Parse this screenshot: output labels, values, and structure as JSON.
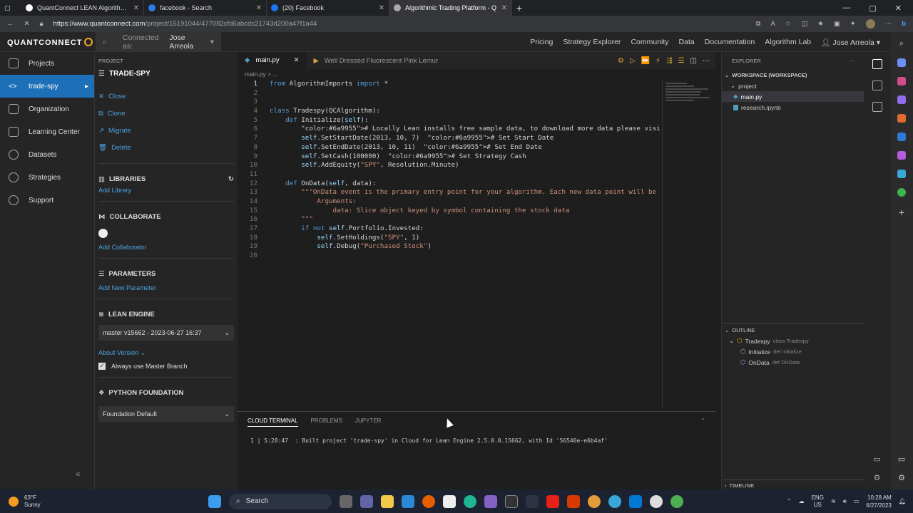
{
  "browser": {
    "tabs": [
      {
        "title": "QuantConnect LEAN Algorithmic",
        "color": "#ffffff"
      },
      {
        "title": "facebook - Search",
        "color": "#2b7de9"
      },
      {
        "title": "(20) Facebook",
        "color": "#1877f2"
      },
      {
        "title": "Algorithmic Trading Platform - Q",
        "color": "#aaaaaa"
      }
    ],
    "url_host": "https://www.quantconnect.com",
    "url_path": "/project/15191044/477082cfd6abcdc21743d200a47f1a44"
  },
  "topnav": {
    "logo": "QUANTCONNECT",
    "connected_label": "Connected as:",
    "connected_user": "Jose Arreola",
    "menu": [
      "Pricing",
      "Strategy Explorer",
      "Community",
      "Data",
      "Documentation",
      "Algorithm Lab"
    ],
    "user": "Jose Arreola"
  },
  "sidebar": {
    "items": [
      {
        "label": "Projects"
      },
      {
        "label": "trade-spy"
      },
      {
        "label": "Organization"
      },
      {
        "label": "Learning Center"
      },
      {
        "label": "Datasets"
      },
      {
        "label": "Strategies"
      },
      {
        "label": "Support"
      }
    ]
  },
  "project": {
    "header": "PROJECT",
    "name": "TRADE-SPY",
    "actions": [
      "Close",
      "Clone",
      "Migrate",
      "Delete"
    ],
    "libraries": "LIBRARIES",
    "add_library": "Add Library",
    "collaborate": "COLLABORATE",
    "add_collaborator": "Add Collaborator",
    "parameters": "PARAMETERS",
    "add_parameter": "Add New Parameter",
    "lean_engine": "LEAN ENGINE",
    "engine_version": "master v15662 - 2023-06-27 16:37",
    "about_version": "About Version",
    "master_branch": "Always use Master Branch",
    "python_foundation": "PYTHON FOUNDATION",
    "foundation_value": "Foundation Default"
  },
  "editor": {
    "tabs": [
      "main.py",
      "Well Dressed Fluorescent Pink Lemur"
    ],
    "breadcrumb": "main.py > ...",
    "lines": [
      "from AlgorithmImports import *",
      "",
      "",
      "class Tradespy(QCAlgorithm):",
      "    def Initialize(self):",
      "        # Locally Lean installs free sample data, to download more data please visit https://www.quantconne",
      "        self.SetStartDate(2013, 10, 7)  # Set Start Date",
      "        self.SetEndDate(2013, 10, 11)  # Set End Date",
      "        self.SetCash(100000)  # Set Strategy Cash",
      "        self.AddEquity(\"SPY\", Resolution.Minute)",
      "",
      "    def OnData(self, data):",
      "        \"\"\"OnData event is the primary entry point for your algorithm. Each new data point will be pumped i",
      "            Arguments:",
      "                data: Slice object keyed by symbol containing the stock data",
      "        \"\"\"",
      "        if not self.Portfolio.Invested:",
      "            self.SetHoldings(\"SPY\", 1)",
      "            self.Debug(\"Purchased Stock\")",
      ""
    ]
  },
  "terminal": {
    "tabs": [
      "CLOUD TERMINAL",
      "PROBLEMS",
      "JUPYTER"
    ],
    "line": "1 | 5:28:47  : Built project 'trade-spy' in Cloud for Lean Engine 2.5.0.0.15662, with Id '56546e-e6b4af'"
  },
  "explorer": {
    "header": "EXPLORER",
    "workspace": "WORKSPACE (WORKSPACE)",
    "folder": "project",
    "files": [
      "main.py",
      "research.ipynb"
    ],
    "outline": "OUTLINE",
    "outline_items": [
      {
        "name": "Tradespy",
        "kind": "class Tradespy"
      },
      {
        "name": "Initialize",
        "kind": "def Initialize"
      },
      {
        "name": "OnData",
        "kind": "def OnData"
      }
    ],
    "timeline": "TIMELINE"
  },
  "taskbar": {
    "temp": "63°F",
    "weather": "Sunny",
    "search": "Search",
    "lang1": "ENG",
    "lang2": "US",
    "time": "10:28 AM",
    "date": "6/27/2023"
  }
}
